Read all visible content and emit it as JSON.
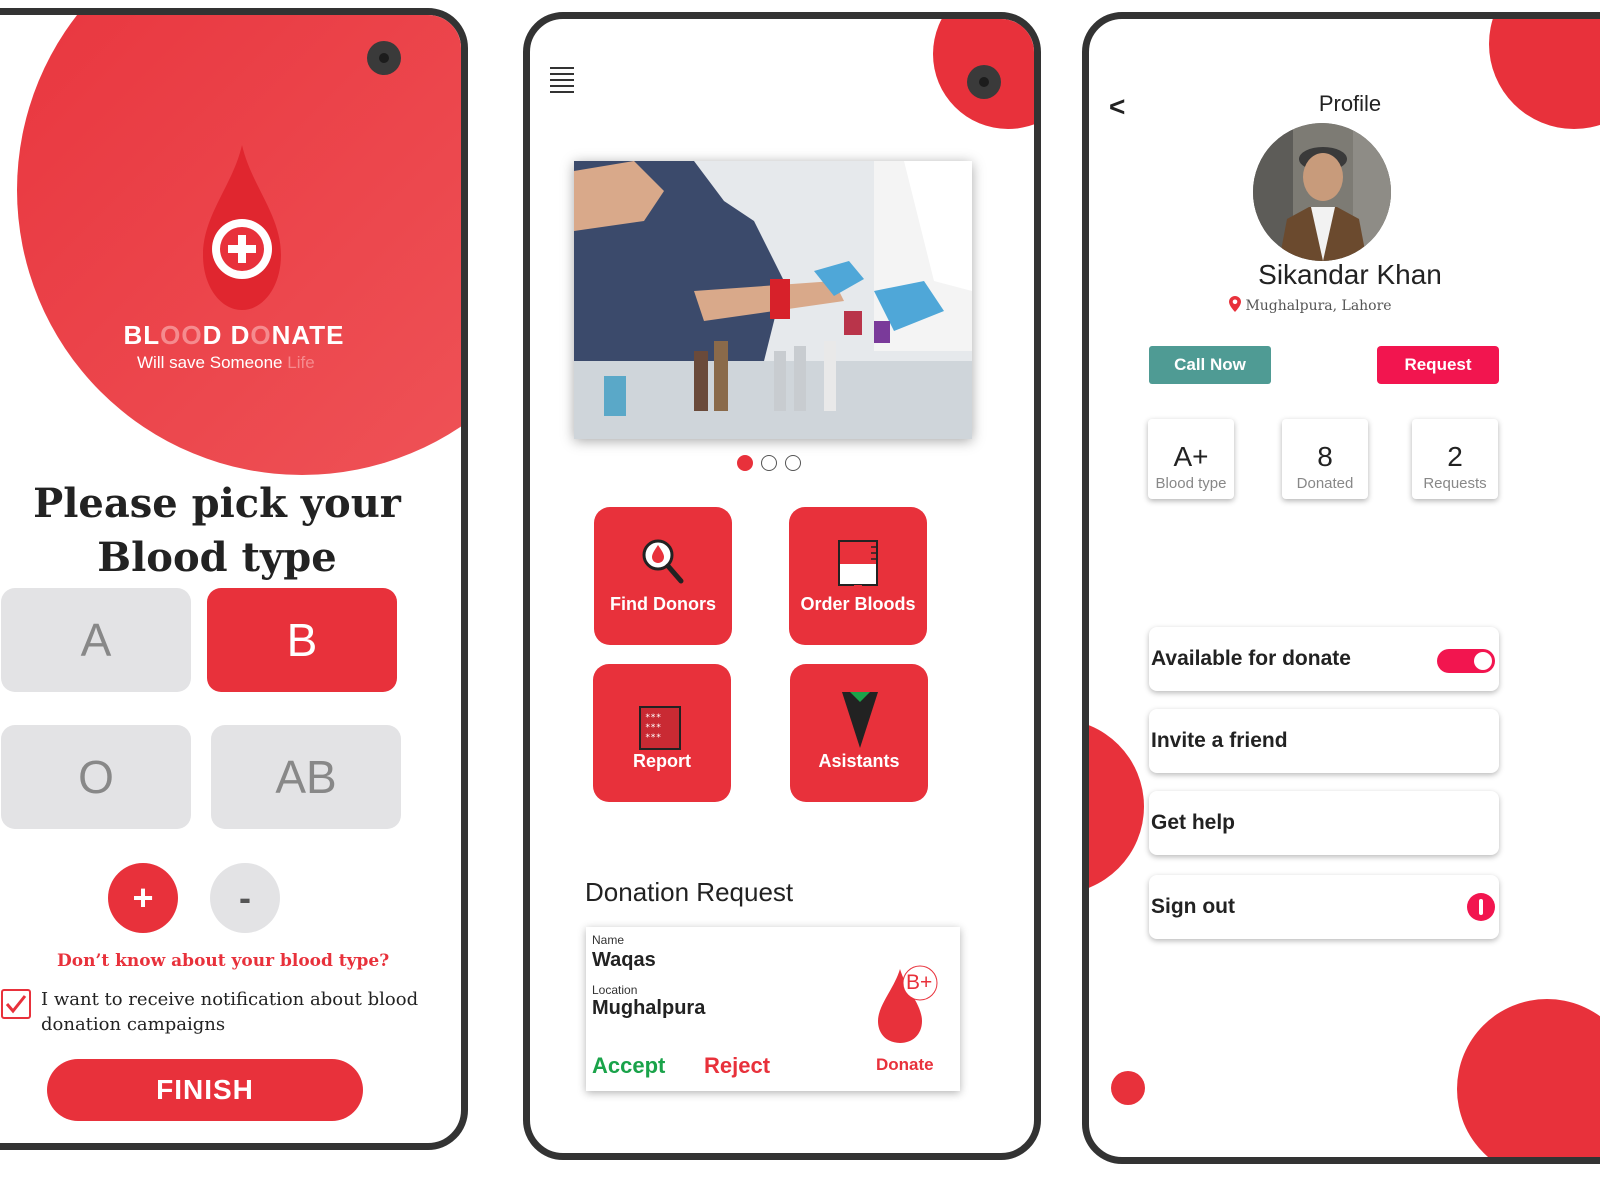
{
  "screen1": {
    "brand_title_parts": [
      "BL",
      "OO",
      "D D",
      "O",
      "NATE"
    ],
    "brand_sub": "Will save Someone",
    "brand_sub_highlight": "Life",
    "pick_title": "Please pick your Blood type",
    "blood_types": [
      {
        "label": "A",
        "selected": false
      },
      {
        "label": "B",
        "selected": true
      },
      {
        "label": "O",
        "selected": false
      },
      {
        "label": "AB",
        "selected": false
      }
    ],
    "plus_label": "+",
    "minus_label": "-",
    "dont_know": "Don’t  know about your blood type?",
    "notify_checked": true,
    "notify_text": "I want to receive notification about blood donation campaigns",
    "finish_label": "FINISH"
  },
  "screen2": {
    "menu_icon": "hamburger-icon",
    "carousel": {
      "count": 3,
      "active": 0
    },
    "tiles": [
      {
        "label": "Find Donors",
        "icon": "search-blood-icon"
      },
      {
        "label": "Order Bloods",
        "icon": "blood-bag-icon"
      },
      {
        "label": "Report",
        "icon": "report-icon"
      },
      {
        "label": "Asistants",
        "icon": "assistant-icon"
      }
    ],
    "donation_title": "Donation Request",
    "request": {
      "name_label": "Name",
      "name": "Waqas",
      "location_label": "Location",
      "location": "Mughalpura",
      "blood_type": "B+",
      "accept_label": "Accept",
      "reject_label": "Reject",
      "donate_label": "Donate"
    }
  },
  "screen3": {
    "back_label": "<",
    "title": "Profile",
    "user_name": "Sikandar Khan",
    "user_location": "Mughalpura, Lahore",
    "call_label": "Call Now",
    "request_label": "Request",
    "stats": [
      {
        "value": "A+",
        "label": "Blood type"
      },
      {
        "value": "8",
        "label": "Donated"
      },
      {
        "value": "2",
        "label": "Requests"
      }
    ],
    "menu": [
      {
        "label": "Available for donate",
        "control": "toggle",
        "on": true
      },
      {
        "label": "Invite a friend"
      },
      {
        "label": "Get help"
      },
      {
        "label": "Sign out",
        "control": "power-icon"
      }
    ]
  },
  "colors": {
    "primary_red": "#e8313b",
    "pink_accent": "#f2154f",
    "teal": "#4f9b94",
    "accept_green": "#1aa34a",
    "button_grey": "#e3e3e5",
    "frame": "#333333"
  }
}
